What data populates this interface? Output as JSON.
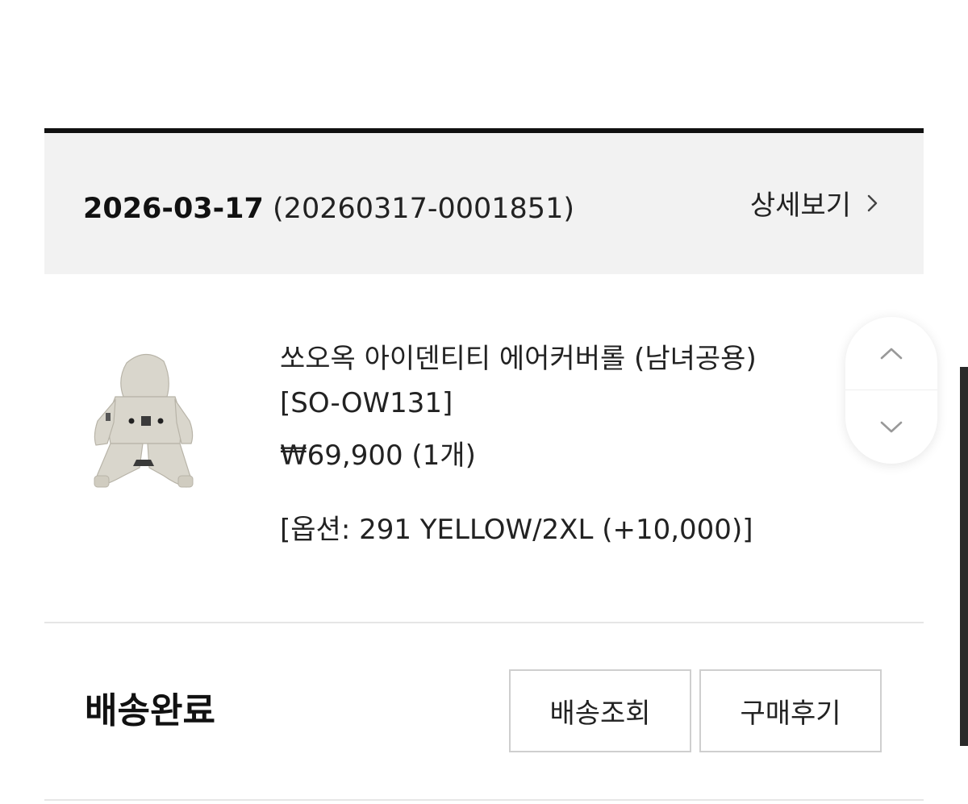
{
  "order": {
    "date": "2026-03-17",
    "number": "(20260317-0001851)",
    "detail_label": "상세보기"
  },
  "product": {
    "name_line1": "쏘오옥 아이덴티티 에어커버롤 (남녀공용)",
    "name_line2": "[SO-OW131]",
    "price": "₩69,900 (1개)",
    "option": "[옵션: 291 YELLOW/2XL (+10,000)]",
    "image_alt": "dog rain coverall"
  },
  "status": {
    "label": "배송완료",
    "tracking_button": "배송조회",
    "review_button": "구매후기"
  },
  "colors": {
    "accent_rule": "#111111",
    "header_bg": "#f2f2f2",
    "border": "#cfcfcf",
    "product_image": "#d9d6cc"
  },
  "icons": {
    "detail": "chevron-right-icon",
    "scroll_up": "chevron-up-icon",
    "scroll_down": "chevron-down-icon"
  }
}
